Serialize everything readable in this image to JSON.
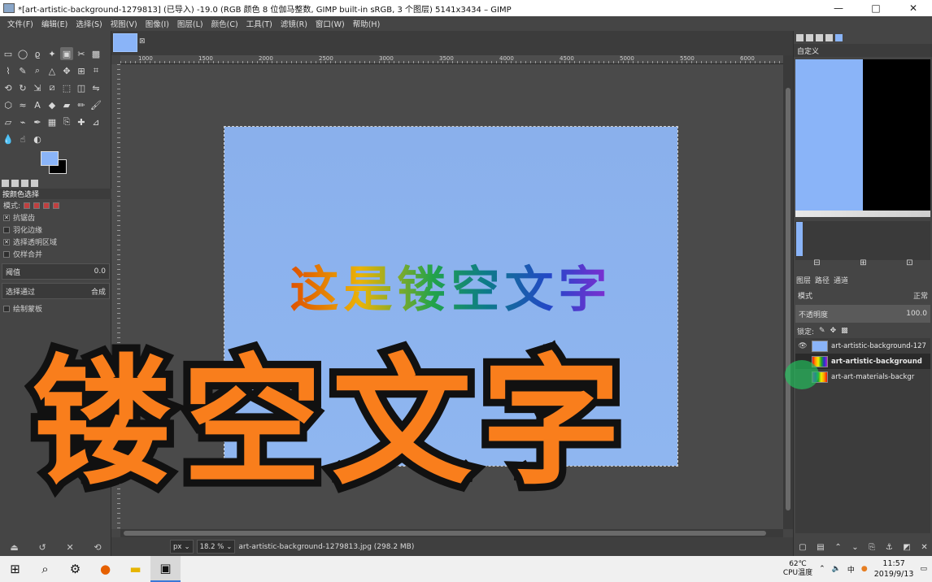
{
  "window": {
    "title": "*[art-artistic-background-1279813] (已导入) -19.0 (RGB 颜色 8 位伽马整数, GIMP built-in sRGB, 3 个图层) 5141x3434 – GIMP",
    "minimize": "—",
    "maximize": "□",
    "close": "✕"
  },
  "menu": [
    "文件(F)",
    "编辑(E)",
    "选择(S)",
    "视图(V)",
    "图像(I)",
    "图层(L)",
    "颜色(C)",
    "工具(T)",
    "滤镜(R)",
    "窗口(W)",
    "帮助(H)"
  ],
  "toolbox": {
    "tools": [
      {
        "name": "rect-select-icon",
        "glyph": "▭"
      },
      {
        "name": "ellipse-select-icon",
        "glyph": "◯"
      },
      {
        "name": "lasso-icon",
        "glyph": "ϱ"
      },
      {
        "name": "fuzzy-select-icon",
        "glyph": "✦"
      },
      {
        "name": "by-color-select-icon",
        "glyph": "▣",
        "active": true
      },
      {
        "name": "scissors-icon",
        "glyph": "✂"
      },
      {
        "name": "foreground-select-icon",
        "glyph": "▩"
      },
      {
        "name": "paths-icon",
        "glyph": "⌇"
      },
      {
        "name": "color-picker-icon",
        "glyph": "✎"
      },
      {
        "name": "zoom-icon",
        "glyph": "⌕"
      },
      {
        "name": "measure-icon",
        "glyph": "△"
      },
      {
        "name": "move-icon",
        "glyph": "✥"
      },
      {
        "name": "align-icon",
        "glyph": "⊞"
      },
      {
        "name": "crop-icon",
        "glyph": "⌗"
      },
      {
        "name": "unified-transform-icon",
        "glyph": "⟲"
      },
      {
        "name": "rotate-icon",
        "glyph": "↻"
      },
      {
        "name": "scale-icon",
        "glyph": "⇲"
      },
      {
        "name": "shear-icon",
        "glyph": "⧄"
      },
      {
        "name": "perspective-icon",
        "glyph": "⬚"
      },
      {
        "name": "3d-transform-icon",
        "glyph": "◫"
      },
      {
        "name": "flip-icon",
        "glyph": "⇋"
      },
      {
        "name": "cage-icon",
        "glyph": "⬡"
      },
      {
        "name": "warp-icon",
        "glyph": "≈"
      },
      {
        "name": "text-icon",
        "glyph": "A"
      },
      {
        "name": "bucket-fill-icon",
        "glyph": "◆"
      },
      {
        "name": "gradient-icon",
        "glyph": "▰"
      },
      {
        "name": "pencil-icon",
        "glyph": "✏"
      },
      {
        "name": "paintbrush-icon",
        "glyph": "🖌"
      },
      {
        "name": "eraser-icon",
        "glyph": "▱"
      },
      {
        "name": "airbrush-icon",
        "glyph": "⌁"
      },
      {
        "name": "ink-icon",
        "glyph": "✒"
      },
      {
        "name": "mypaint-brush-icon",
        "glyph": "▦"
      },
      {
        "name": "clone-icon",
        "glyph": "⎘"
      },
      {
        "name": "heal-icon",
        "glyph": "✚"
      },
      {
        "name": "perspective-clone-icon",
        "glyph": "⊿"
      },
      {
        "name": "blur-icon",
        "glyph": "💧"
      },
      {
        "name": "smudge-icon",
        "glyph": "☝"
      },
      {
        "name": "dodge-burn-icon",
        "glyph": "◐"
      }
    ],
    "options": {
      "title": "按颜色选择",
      "mode_label": "模式:",
      "antialias": "抗锯齿",
      "feather": "羽化边缘",
      "select_transparent": "选择透明区域",
      "sample_merged": "仅样合并",
      "threshold_label": "阈值",
      "threshold_value": "0.0",
      "select_by_label": "选择通过",
      "select_by_value": "合成",
      "draw_mask": "绘制蒙板"
    }
  },
  "canvas": {
    "ruler_labels": [
      "1000",
      "1500",
      "2000",
      "2500",
      "3000",
      "3500",
      "4000",
      "4500",
      "5000",
      "5500",
      "6000"
    ],
    "image_text": "这是镂空文字",
    "status": {
      "unit": "px",
      "zoom": "18.2 %",
      "file": "art-artistic-background-1279813.jpg (298.2 MB)"
    }
  },
  "overlay_text": "镂空文字",
  "dock": {
    "gradient_label": "自定义",
    "layers_tab": "图层",
    "paths_tab": "路径",
    "channels_tab": "通道",
    "mode_label": "模式",
    "mode_value": "正常",
    "opacity_label": "不透明度",
    "opacity_value": "100.0",
    "lock_label": "锁定:",
    "layers": [
      {
        "name": "art-artistic-background-127",
        "selected": false,
        "visible": true
      },
      {
        "name": "art-artistic-background",
        "selected": true,
        "visible": false
      },
      {
        "name": "art-art-materials-backgr",
        "selected": false,
        "visible": false
      }
    ]
  },
  "taskbar": {
    "temp_value": "62℃",
    "temp_label": "CPU温度",
    "ime": "中",
    "time": "11:57",
    "date": "2019/9/13"
  }
}
